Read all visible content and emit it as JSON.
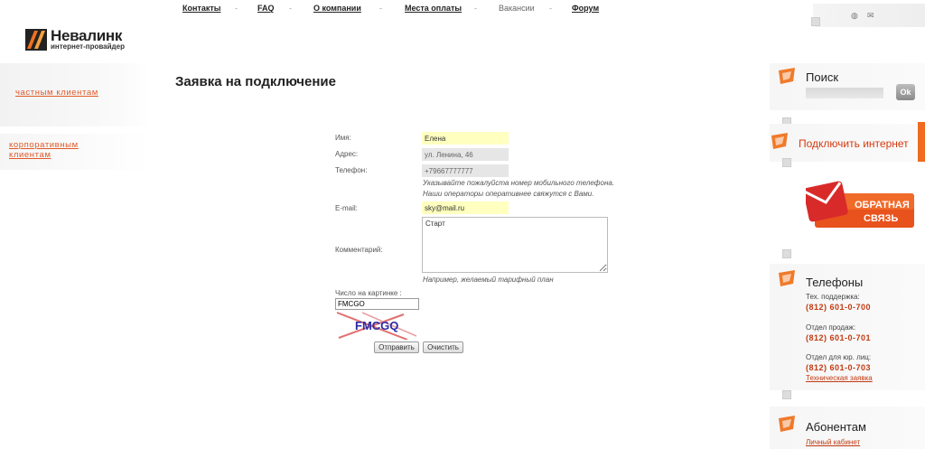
{
  "topnav": {
    "items": [
      "Контакты",
      "FAQ",
      "О компании",
      "Места оплаты",
      "Вакансии",
      "Форум"
    ],
    "separator": "-"
  },
  "logo": {
    "title": "Невалинк",
    "subtitle": "интернет-провайдер"
  },
  "sidebar": {
    "private": "частным клиентам",
    "corporate_line1": "корпоративным",
    "corporate_line2": "клиентам"
  },
  "page": {
    "title": "Заявка на подключение"
  },
  "form": {
    "name_label": "Имя:",
    "name_value": "Елена",
    "address_label": "Адрес:",
    "address_value": "ул. Ленина, 46",
    "phone_label": "Телефон:",
    "phone_value": "+79667777777",
    "phone_hint_1": "Указывайте пожалуйста номер мобильного телефона.",
    "phone_hint_2": "Наши операторы оперативнее свяжутся с Вами.",
    "email_label": "E-mail:",
    "email_value": "sky@mail.ru",
    "comment_label": "Комментарий:",
    "comment_value": "Старт",
    "comment_hint": "Например, желаемый тарифный план",
    "captcha_label": "Число на картинке :",
    "captcha_value": "FMCGO",
    "captcha_image_text": "FMCGQ",
    "submit": "Отправить",
    "clear": "Очистить"
  },
  "right": {
    "search_title": "Поиск",
    "ok": "Ok",
    "connect": "Подключить интернет",
    "feedback_line1": "ОБРАТНАЯ",
    "feedback_line2": "СВЯЗЬ",
    "phones_title": "Телефоны",
    "support_label": "Тех. поддержка:",
    "support_phone": "(812) 601-0-700",
    "sales_label": "Отдел продаж:",
    "sales_phone": "(812) 601-0-701",
    "legal_label": "Отдел для юр. лиц:",
    "legal_phone": "(812) 601-0-703",
    "tech_request": "Техническая заявка",
    "subscribers_title": "Абонентам",
    "cabinet": "Личный кабинет"
  },
  "colors": {
    "accent": "#e05a2a",
    "phone": "#c23a12",
    "field_yellow": "#ffffc0"
  }
}
